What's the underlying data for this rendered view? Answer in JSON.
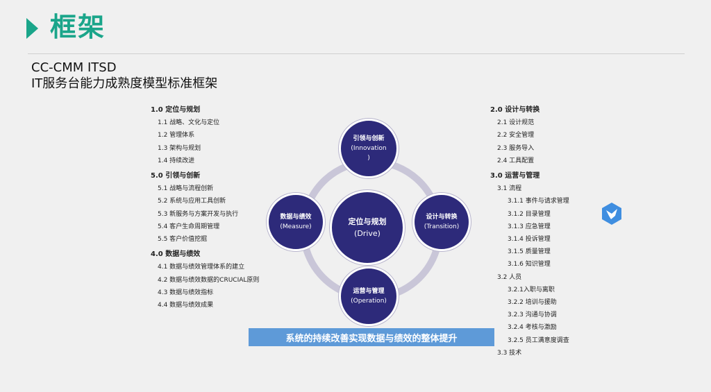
{
  "header": {
    "title": "框架",
    "subtitle_line1": "CC-CMM ITSD",
    "subtitle_line2": "IT服务台能力成熟度模型标准框架"
  },
  "left_column": [
    {
      "level": "h",
      "text": "1.0 定位与规划"
    },
    {
      "level": "i1",
      "text": "1.1 战略、文化与定位"
    },
    {
      "level": "i1",
      "text": "1.2 管理体系"
    },
    {
      "level": "i1",
      "text": "1.3 架构与规划"
    },
    {
      "level": "i1",
      "text": "1.4 持续改进"
    },
    {
      "level": "h",
      "text": "5.0 引领与创新"
    },
    {
      "level": "i1",
      "text": "5.1 战略与流程创新"
    },
    {
      "level": "i1",
      "text": "5.2 系统与应用工具创新"
    },
    {
      "level": "i1",
      "text": "5.3 新服务与方案开发与执行"
    },
    {
      "level": "i1",
      "text": "5.4 客户生命周期管理"
    },
    {
      "level": "i1",
      "text": "5.5 客户价值挖掘"
    },
    {
      "level": "h",
      "text": "4.0 数据与绩效"
    },
    {
      "level": "i1",
      "text": "4.1 数据与绩效管理体系的建立"
    },
    {
      "level": "i1",
      "text": "4.2 数据与绩效数据的CRUCIAL原则"
    },
    {
      "level": "i1",
      "text": "4.3 数据与绩效指标"
    },
    {
      "level": "i1",
      "text": "4.4 数据与绩效成果"
    }
  ],
  "right_column": [
    {
      "level": "h",
      "text": "2.0 设计与转换"
    },
    {
      "level": "i1",
      "text": "2.1 设计规范"
    },
    {
      "level": "i1",
      "text": "2.2 安全管理"
    },
    {
      "level": "i1",
      "text": "2.3 服务导入"
    },
    {
      "level": "i1",
      "text": "2.4 工具配置"
    },
    {
      "level": "h",
      "text": "3.0 运营与管理"
    },
    {
      "level": "i1",
      "text": "3.1 流程"
    },
    {
      "level": "i2",
      "text": "3.1.1 事件与请求管理"
    },
    {
      "level": "i2",
      "text": "3.1.2 目录管理"
    },
    {
      "level": "i2",
      "text": "3.1.3 应急管理"
    },
    {
      "level": "i2",
      "text": "3.1.4 投诉管理"
    },
    {
      "level": "i2",
      "text": "3.1.5 质量管理"
    },
    {
      "level": "i2",
      "text": "3.1.6 知识管理"
    },
    {
      "level": "i1",
      "text": "3.2 人员"
    },
    {
      "level": "i2",
      "text": "3.2.1入职与离职"
    },
    {
      "level": "i2",
      "text": "3.2.2 培训与援助"
    },
    {
      "level": "i2",
      "text": "3.2.3 沟通与协调"
    },
    {
      "level": "i2",
      "text": "3.2.4 考核与激励"
    },
    {
      "level": "i2",
      "text": "3.2.5 员工满意度调查"
    },
    {
      "level": "i1",
      "text": "3.3 技术"
    }
  ],
  "diagram": {
    "top": {
      "title": "引领与创新",
      "en": "(Innovation",
      "en2": ")"
    },
    "left": {
      "title": "数据与绩效",
      "en": "(Measure)"
    },
    "right": {
      "title": "设计与转换",
      "en": "(Transition)"
    },
    "bottom": {
      "title": "运营与管理",
      "en": "(Operation)"
    },
    "center": {
      "title": "定位与规划",
      "en": "(Drive)"
    },
    "banner": "系统的持续改善实现数据与绩效的整体提升"
  },
  "colors": {
    "accent": "#1aa58a",
    "node": "#2d2a7a",
    "ring": "#c9c6d8",
    "banner": "#5e9ad8"
  },
  "icons": {
    "app_badge": "bird-logo-icon"
  }
}
